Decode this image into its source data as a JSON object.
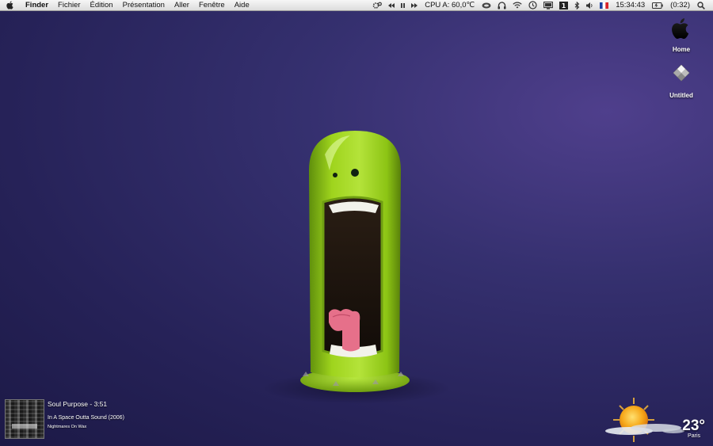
{
  "menubar": {
    "app_name": "Finder",
    "menus": [
      "Fichier",
      "Édition",
      "Présentation",
      "Aller",
      "Fenêtre",
      "Aide"
    ],
    "status": {
      "cpu": "CPU A: 60,0℃",
      "clock": "15:34:43",
      "battery": "(0:32)"
    }
  },
  "desktop": {
    "icons": [
      {
        "label": "Home",
        "icon": "apple-logo-icon"
      },
      {
        "label": "Untitled",
        "icon": "drive-icon"
      }
    ]
  },
  "now_playing": {
    "title": "Soul Purpose - 3:51",
    "album": "In A Space Outta Sound (2006)",
    "artist": "Nightmares On Wax"
  },
  "weather": {
    "temperature": "23°",
    "city": "Paris",
    "condition_icon": "sun-cloud-icon"
  },
  "colors": {
    "desktop_bg": "#2f2a66",
    "character_green": "#9bd31a",
    "menubar_bg": "#e8e8e8"
  }
}
